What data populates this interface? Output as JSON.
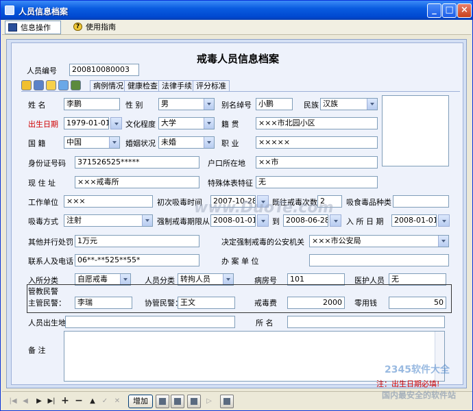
{
  "window": {
    "title": "人员信息档案"
  },
  "menu": {
    "items": [
      "信息操作",
      "使用指南"
    ]
  },
  "form": {
    "title": "戒毒人员信息档案"
  },
  "person_no": {
    "label": "人员编号",
    "value": "200810080003"
  },
  "tabs": [
    "病例情况",
    "健康检查",
    "法律手续",
    "评分标准"
  ],
  "toolbar_icons": [
    "add-icon",
    "save-icon",
    "smile-icon",
    "search-icon",
    "export-icon"
  ],
  "fields": {
    "name": {
      "label": "姓    名",
      "value": "李鹏"
    },
    "gender": {
      "label": "性    别",
      "value": "男"
    },
    "alias": {
      "label": "别名绰号",
      "value": "小鹏"
    },
    "ethnic": {
      "label": "民族",
      "value": "汉族"
    },
    "birth": {
      "label": "出生日期",
      "value": "1979-01-01"
    },
    "education": {
      "label": "文化程度",
      "value": "大学"
    },
    "native": {
      "label": "籍    贯",
      "value": "×××市北园小区"
    },
    "nationality": {
      "label": "国    籍",
      "value": "中国"
    },
    "marital": {
      "label": "婚姻状况",
      "value": "未婚"
    },
    "job": {
      "label": "职    业",
      "value": "×××××"
    },
    "id_no": {
      "label": "身份证号码",
      "value": "371526525*****"
    },
    "hukou": {
      "label": "户口所在地",
      "value": "××市"
    },
    "address": {
      "label": "现 住 址",
      "value": "×××戒毒所"
    },
    "feature": {
      "label": "特殊体表特征",
      "value": "无"
    },
    "work_unit": {
      "label": "工作单位",
      "value": "×××"
    },
    "first_drug": {
      "label": "初次吸毒时间",
      "value": "2007-10-28"
    },
    "past_count": {
      "label": "既往戒毒次数",
      "value": "2"
    },
    "drug_type": {
      "label": "吸食毒品种类",
      "value": ""
    },
    "method": {
      "label": "吸毒方式",
      "value": "注射"
    },
    "period_from": {
      "label": "强制戒毒期限从",
      "value": "2008-01-01"
    },
    "period_to_label": "到",
    "period_to": {
      "value": "2008-06-28"
    },
    "enter_date": {
      "label": "入 所 日 期",
      "value": "2008-01-01"
    },
    "penalty": {
      "label": "其他并行处罚",
      "value": "1万元"
    },
    "police_org": {
      "label": "决定强制戒毒的公安机关",
      "value": "×××市公安局"
    },
    "contact": {
      "label": "联系人及电话",
      "value": "06**-**525**55*"
    },
    "case_unit": {
      "label": "办    案    单    位",
      "value": ""
    },
    "enter_type": {
      "label": "入所分类",
      "value": "自愿戒毒"
    },
    "person_type": {
      "label": "人员分类",
      "value": "转拘人员"
    },
    "room": {
      "label": "病房号",
      "value": "101"
    },
    "medic": {
      "label": "医护人员",
      "value": "无"
    },
    "police_group": "管教民警",
    "main_police": {
      "label": "主管民警：",
      "value": "李瑞"
    },
    "assist_police": {
      "label": "协管民警：",
      "value": "王文"
    },
    "fee": {
      "label": "戒毒费",
      "value": "2000"
    },
    "pocket": {
      "label": "零用钱",
      "value": "50"
    },
    "birthplace": {
      "label": "人员出生地",
      "value": ""
    },
    "institution": {
      "label": "所    名",
      "value": ""
    },
    "remark": {
      "label": "备    注",
      "value": ""
    }
  },
  "hint": "注：出生日期必填!",
  "statusbar": {
    "add_label": "增加"
  },
  "watermarks": {
    "main": "www.DuoTe.com",
    "brand": "2345软件大全",
    "slogan": "国内最安全的软件站"
  }
}
